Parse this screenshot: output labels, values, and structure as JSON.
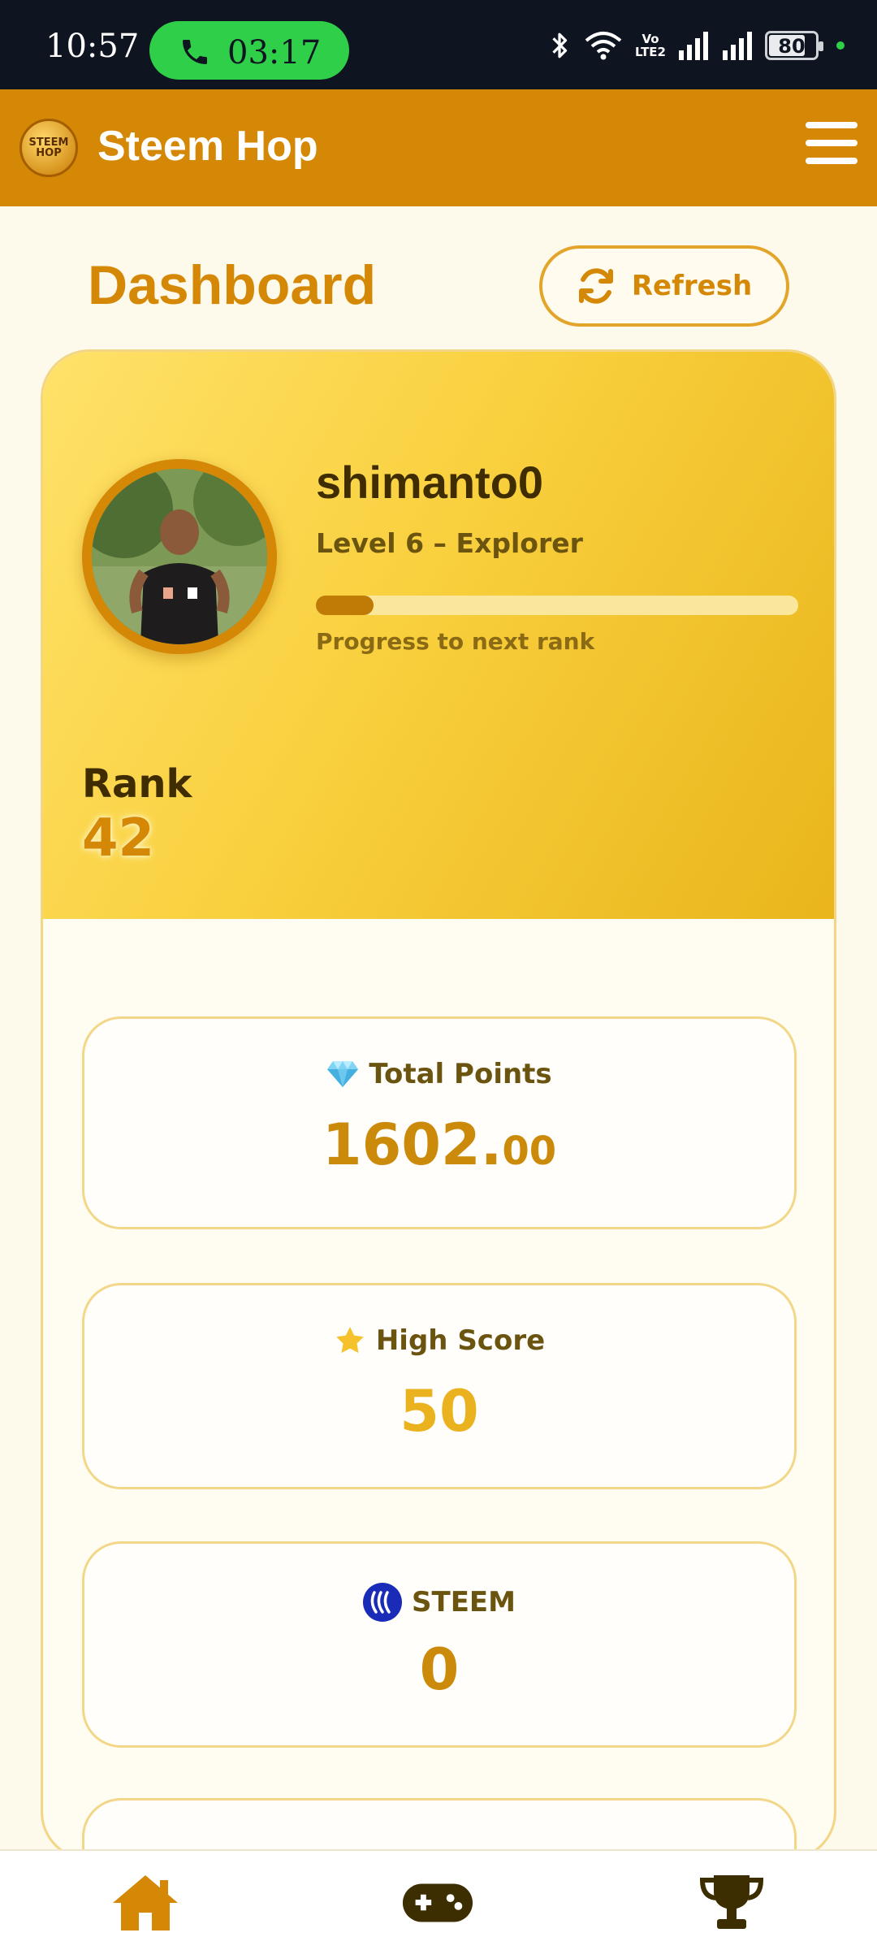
{
  "status_bar": {
    "time": "10:57",
    "call_timer": "03:17",
    "volte": [
      "Vo",
      "LTE2"
    ],
    "battery": "80",
    "battery_level": 0.8,
    "icons": [
      "bluetooth-icon",
      "wifi-icon",
      "volte-icon",
      "signal-icon",
      "signal-icon",
      "battery-icon"
    ]
  },
  "header": {
    "logo_text": [
      "STEEM",
      "HOP"
    ],
    "title": "Steem Hop",
    "menu_icon": "hamburger-menu-icon"
  },
  "page": {
    "title": "Dashboard",
    "refresh_label": "Refresh"
  },
  "profile": {
    "username": "shimanto0",
    "level": "Level 6 – Explorer",
    "progress_fraction": 0.12,
    "progress_label": "Progress to next rank",
    "rank_label": "Rank",
    "rank_value": "42"
  },
  "stats": {
    "total_points": {
      "label": "Total Points",
      "icon": "gem-icon",
      "value_int": "1602.",
      "value_dec": "00",
      "color": "#cc8a0b"
    },
    "high_score": {
      "label": "High Score",
      "icon": "star-icon",
      "value": "50",
      "color": "#eab21e"
    },
    "steem": {
      "label": "STEEM",
      "icon": "steem-logo-icon",
      "value": "0",
      "color": "#cc8a0b"
    }
  },
  "bottom_nav": {
    "items": [
      {
        "icon": "home-icon",
        "active": true
      },
      {
        "icon": "gamepad-icon",
        "active": false
      },
      {
        "icon": "trophy-icon",
        "active": false
      }
    ]
  },
  "colors": {
    "header": "#d48806",
    "accent": "#d48806",
    "background": "#fefaeb"
  }
}
